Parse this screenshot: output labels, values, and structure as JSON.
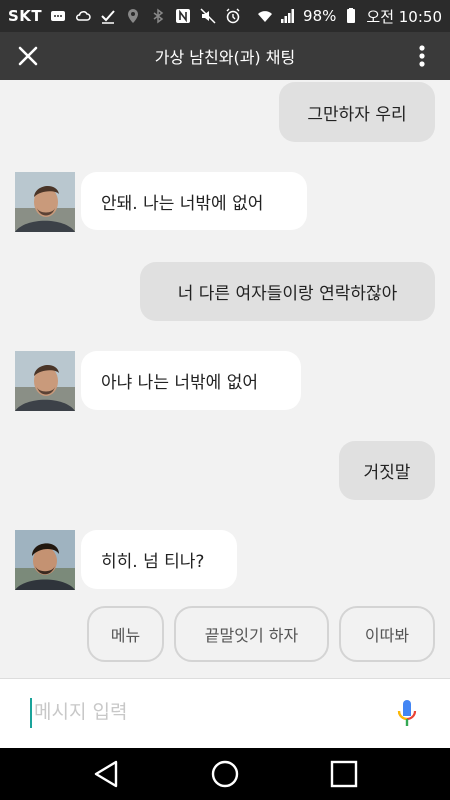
{
  "status_bar": {
    "carrier": "SKT",
    "battery": "98%",
    "time": "오전 10:50",
    "icons": [
      "message-icon",
      "cloud-icon",
      "check-icon",
      "location-icon",
      "bluetooth-icon",
      "nfc-icon",
      "mute-icon",
      "alarm-icon",
      "wifi-icon",
      "signal-icon",
      "battery-icon"
    ]
  },
  "app_bar": {
    "title": "가상 남친와(과) 채팅",
    "close_icon": "close-icon",
    "menu_icon": "more-vert-icon"
  },
  "messages": [
    {
      "from": "user",
      "text": "그만하자 우리"
    },
    {
      "from": "bot",
      "text": "안돼. 나는 너밖에 없어"
    },
    {
      "from": "user",
      "text": "너 다른 여자들이랑 연락하잖아"
    },
    {
      "from": "bot",
      "text": "아냐 나는 너밖에 없어"
    },
    {
      "from": "user",
      "text": "거짓말"
    },
    {
      "from": "bot",
      "text": "히히. 넘 티나?"
    }
  ],
  "quick_replies": [
    "메뉴",
    "끝말잇기 하자",
    "이따봐"
  ],
  "input": {
    "placeholder": "메시지 입력",
    "mic_icon": "mic-icon"
  },
  "nav_bar": {
    "icons": [
      "back-icon",
      "home-icon",
      "recents-icon"
    ]
  },
  "colors": {
    "status_bar": "#2b2b2b",
    "app_bar": "#3a3a3a",
    "chat_background": "#f2f2f2",
    "user_bubble": "#e0e0e0",
    "bot_bubble": "#ffffff",
    "cursor": "#1aa39a"
  }
}
